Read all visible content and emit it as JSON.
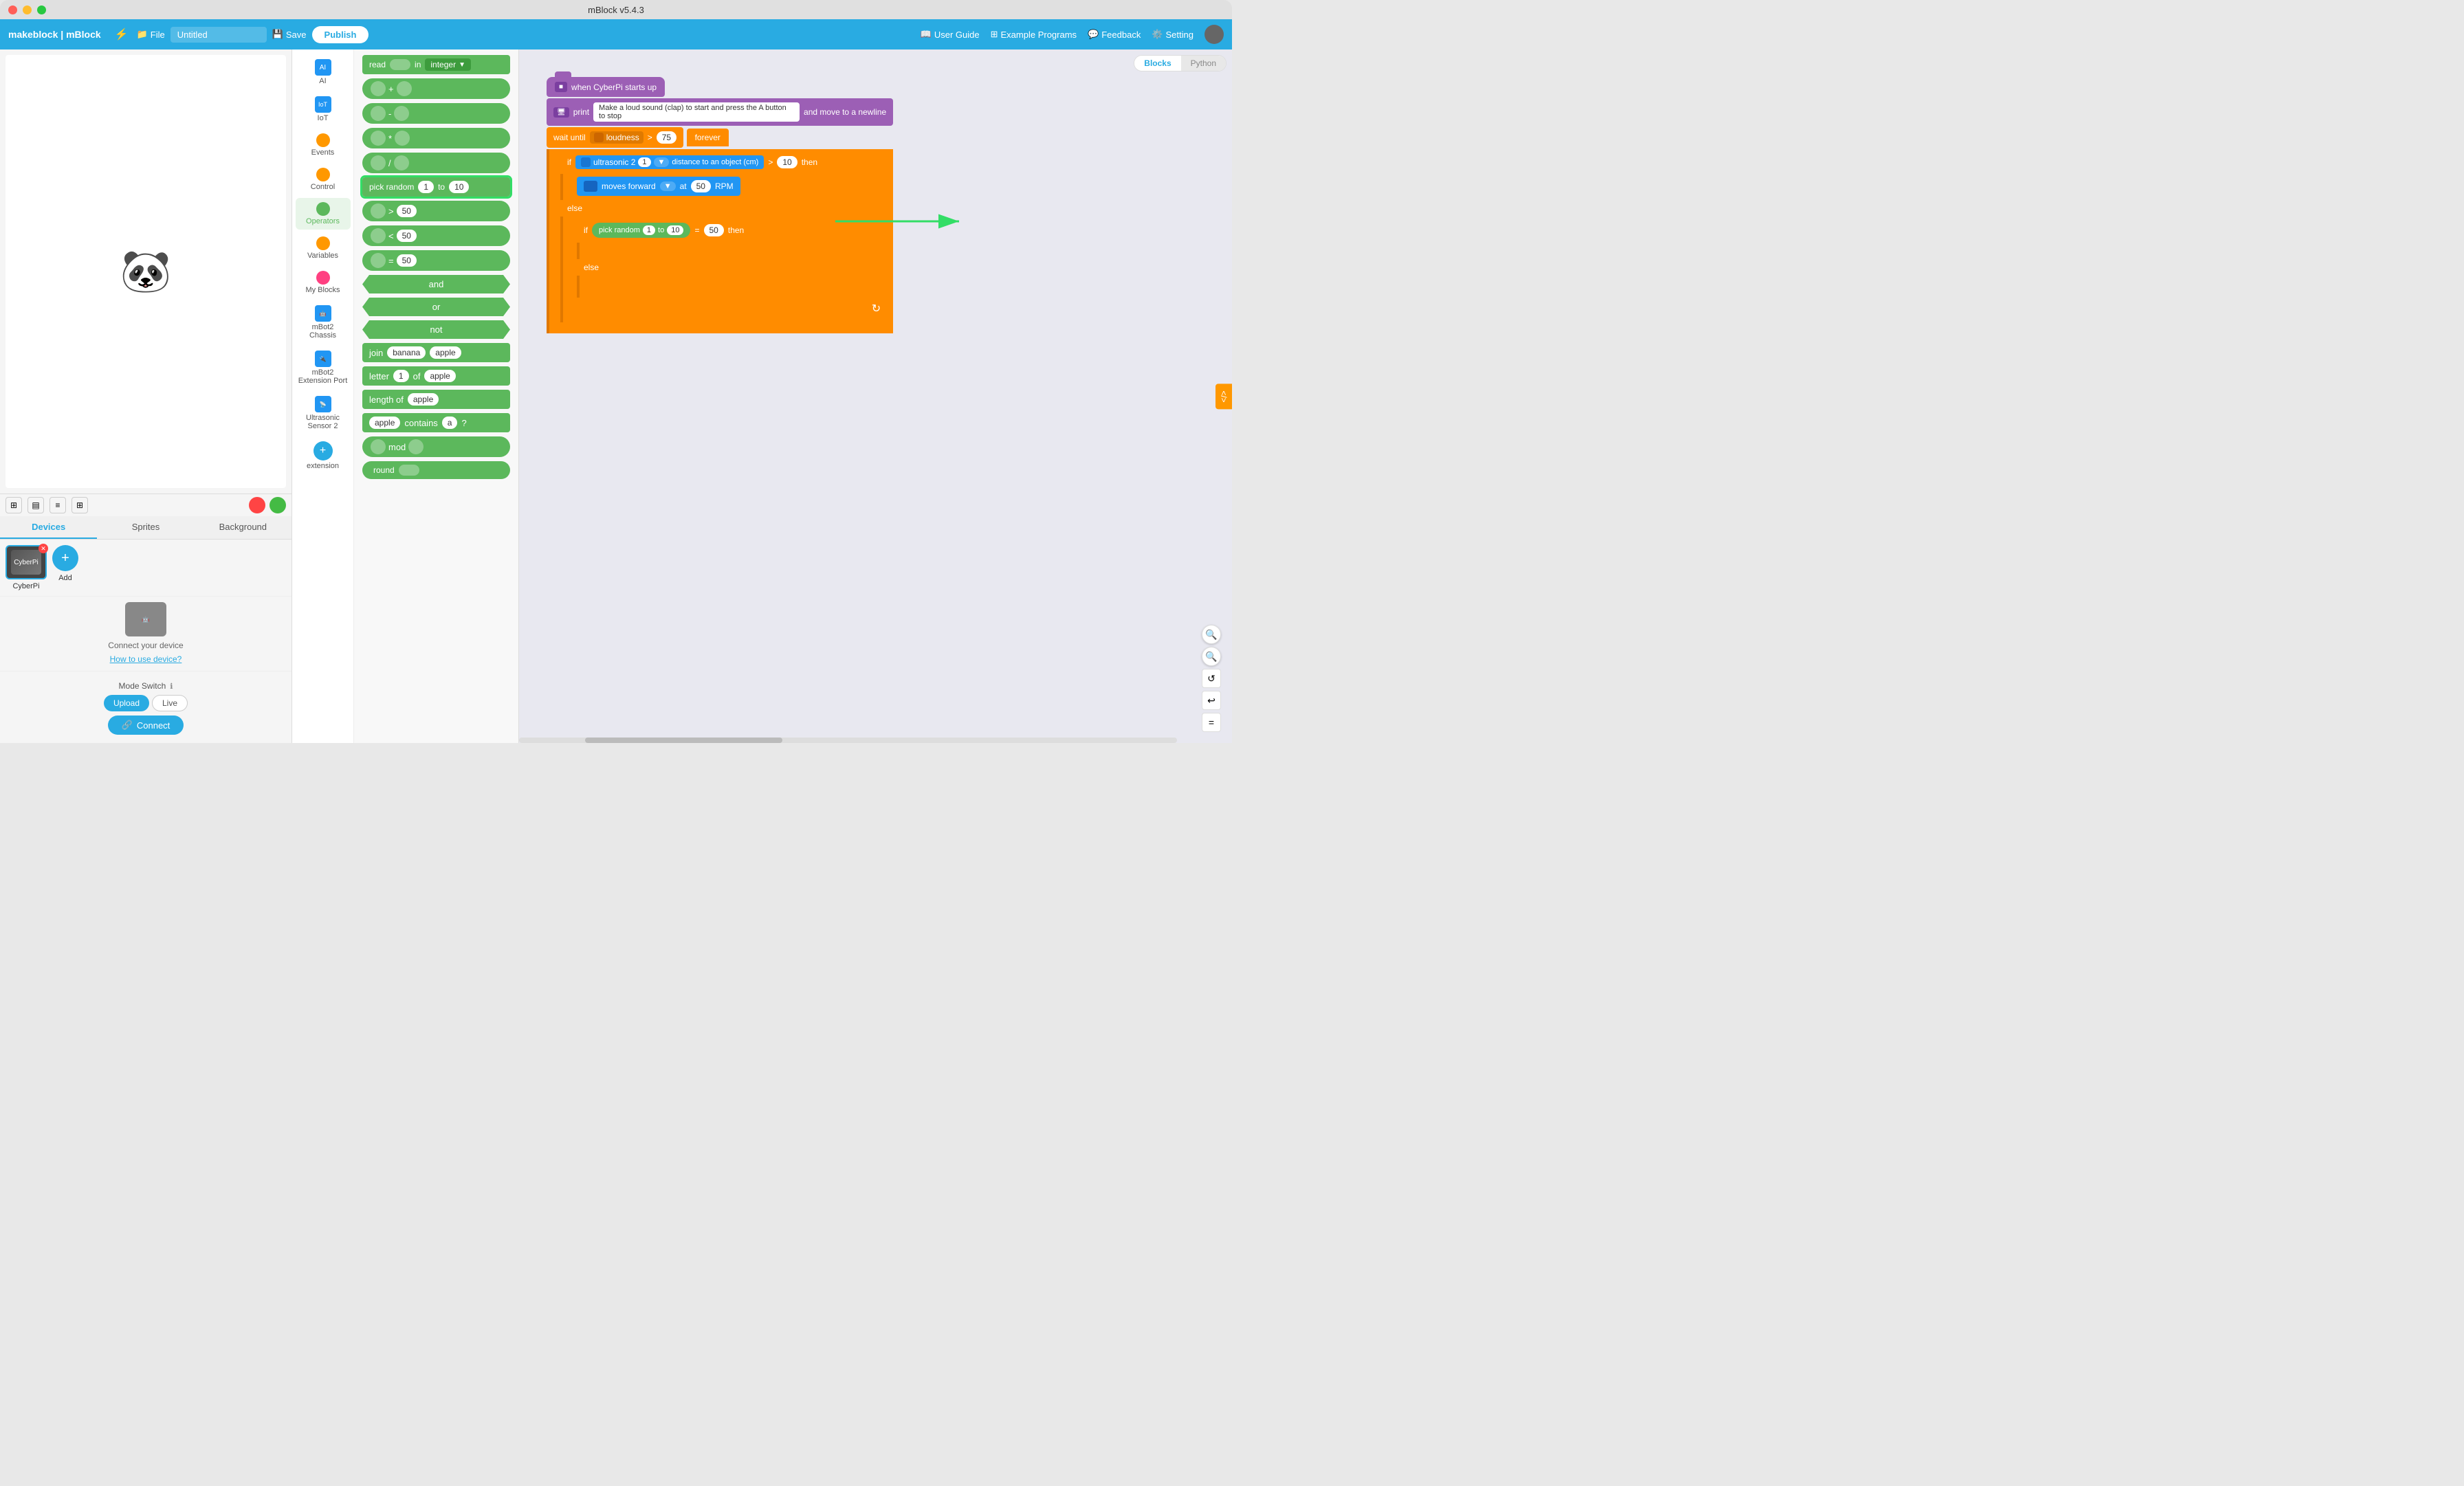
{
  "window": {
    "title": "mBlock v5.4.3"
  },
  "menubar": {
    "logo": "makeblock | mBlock",
    "file_label": "File",
    "title_value": "Untitled",
    "save_label": "Save",
    "publish_label": "Publish",
    "user_guide": "User Guide",
    "example_programs": "Example Programs",
    "feedback": "Feedback",
    "setting": "Setting"
  },
  "stage": {
    "stop_icon": "⬛",
    "go_icon": "▶"
  },
  "tabs": {
    "devices": "Devices",
    "sprites": "Sprites",
    "background": "Background"
  },
  "device": {
    "name": "CyberPi",
    "add_label": "Add",
    "connect_hint": "Connect your device",
    "how_to": "How to use device?",
    "mode_switch": "Mode Switch",
    "upload": "Upload",
    "live": "Live",
    "connect": "Connect"
  },
  "categories": [
    {
      "id": "ai",
      "label": "AI",
      "color": "#2196f3",
      "shape": "square"
    },
    {
      "id": "iot",
      "label": "IoT",
      "color": "#2196f3",
      "shape": "square"
    },
    {
      "id": "events",
      "label": "Events",
      "color": "#ff9800",
      "shape": "circle"
    },
    {
      "id": "control",
      "label": "Control",
      "color": "#ff9800",
      "shape": "circle"
    },
    {
      "id": "operators",
      "label": "Operators",
      "color": "#5cb85c",
      "shape": "circle"
    },
    {
      "id": "variables",
      "label": "Variables",
      "color": "#ff9800",
      "shape": "circle"
    },
    {
      "id": "my_blocks",
      "label": "My Blocks",
      "color": "#ff4081",
      "shape": "circle"
    },
    {
      "id": "mbot2",
      "label": "mBot2 Chassis",
      "color": "#2196f3",
      "shape": "square"
    },
    {
      "id": "mbot2ext",
      "label": "mBot2 Extension Port",
      "color": "#2196f3",
      "shape": "square"
    },
    {
      "id": "ultrasonic",
      "label": "Ultrasonic Sensor 2",
      "color": "#2196f3",
      "shape": "square"
    },
    {
      "id": "extension",
      "label": "extension",
      "color": "#29abe2",
      "shape": "plus"
    }
  ],
  "blocks": {
    "read_block": "read",
    "read_in": "in",
    "read_type": "integer",
    "plus": "+",
    "minus": "-",
    "multiply": "*",
    "divide": "/",
    "pick_random": "pick random",
    "pick_from": "1",
    "pick_to": "to",
    "pick_end": "10",
    "greater": "> 50",
    "less": "< 50",
    "equal": "= 50",
    "and": "and",
    "or": "or",
    "not": "not",
    "join": "join",
    "join_a": "banana",
    "join_b": "apple",
    "letter": "letter",
    "letter_num": "1",
    "letter_of": "of",
    "letter_word": "apple",
    "length": "length of",
    "length_word": "apple",
    "contains": "contains",
    "contains_a": "apple",
    "contains_b": "a",
    "contains_q": "?",
    "mod": "mod",
    "round": "round"
  },
  "canvas_blocks": {
    "when_start": "when CyberPi starts up",
    "print_label": "print",
    "print_text": "Make a loud sound (clap) to start and press the A button to stop",
    "print_suffix": "and move to a newline",
    "wait_until": "wait until",
    "loudness_label": "loudness",
    "loudness_gt": ">",
    "loudness_val": "75",
    "forever": "forever",
    "if_label": "if",
    "ultrasonic": "ultrasonic 2",
    "ultrasonic_num": "1",
    "dist_label": "distance to an object (cm)",
    "dist_gt": ">",
    "dist_val": "10",
    "then": "then",
    "moves_forward": "moves forward",
    "at": "at",
    "rpm_val": "50",
    "rpm": "RPM",
    "else": "else",
    "pick_random_label": "pick random",
    "pick_1": "1",
    "pick_to": "to",
    "pick_10": "10",
    "eq": "=",
    "eq_val": "50",
    "then2": "then"
  },
  "view_toggle": {
    "blocks": "Blocks",
    "python": "Python"
  },
  "zoom": {
    "zoom_in": "+",
    "zoom_out": "-",
    "reset": "↺",
    "undo": "↩",
    "eq": "="
  }
}
